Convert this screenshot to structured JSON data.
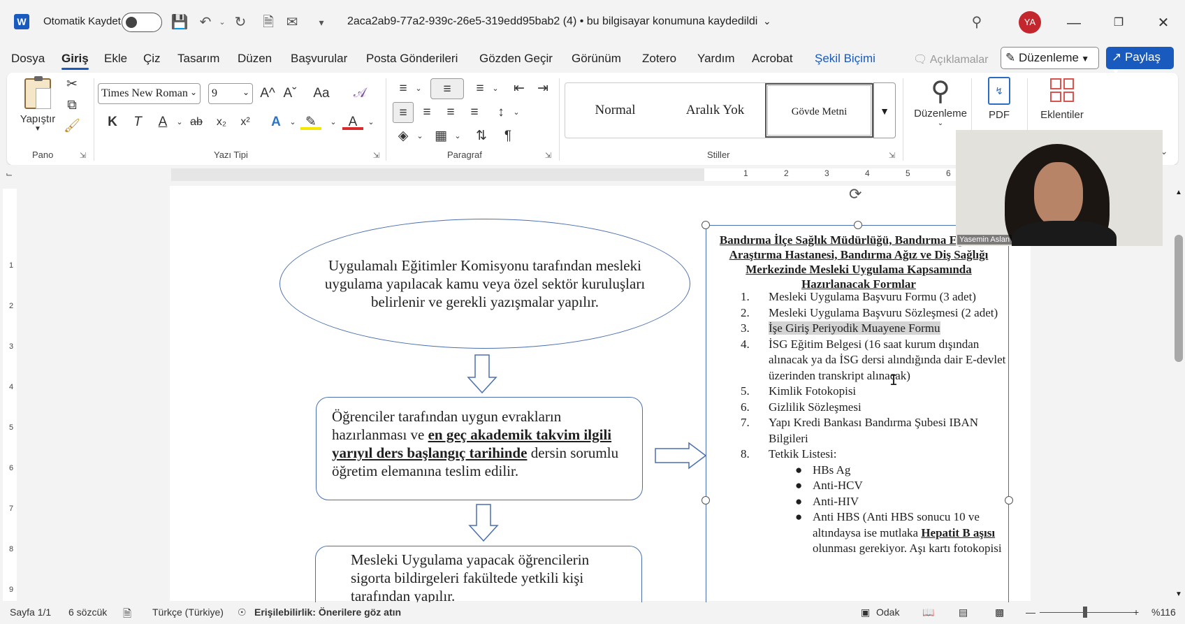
{
  "titlebar": {
    "app_icon": "W",
    "autosave_label": "Otomatik Kaydet",
    "doc_title": "2aca2ab9-77a2-939c-26e5-319edd95bab2 (4)  •  bu bilgisayar konumuna kaydedildi",
    "avatar_initials": "YA"
  },
  "menu": {
    "items": [
      "Dosya",
      "Giriş",
      "Ekle",
      "Çiz",
      "Tasarım",
      "Düzen",
      "Başvurular",
      "Posta Gönderileri",
      "Gözden Geçir",
      "Görünüm",
      "Zotero",
      "Yardım",
      "Acrobat",
      "Şekil Biçimi"
    ],
    "comments_label": "Açıklamalar",
    "editing_label": "Düzenleme",
    "share_label": "Paylaş"
  },
  "ribbon": {
    "paste_label": "Yapıştır",
    "clipboard_group": "Pano",
    "font_name": "Times New Roman",
    "font_size": "9",
    "font_group": "Yazı Tipi",
    "paragraph_group": "Paragraf",
    "styles": [
      "Normal",
      "Aralık Yok",
      "Gövde Metni"
    ],
    "styles_group": "Stiller",
    "editing_label": "Düzenleme",
    "pdf_label": "PDF",
    "addins_label": "Eklentiler",
    "bold": "K",
    "italic": "T",
    "underline": "A",
    "strike": "ab",
    "sub": "x₂",
    "sup": "x²",
    "change_case": "Aa",
    "grow_font": "A^",
    "shrink_font": "Aˇ"
  },
  "ruler": {
    "numbers": [
      "1",
      "2",
      "3",
      "4",
      "5",
      "6"
    ],
    "vnumbers": [
      "1",
      "2",
      "3",
      "4",
      "5",
      "6",
      "7",
      "8",
      "9"
    ]
  },
  "document": {
    "ellipse_text": "Uygulamalı Eğitimler Komisyonu tarafından mesleki uygulama yapılacak kamu veya özel sektör kuruluşları belirlenir ve gerekli yazışmalar yapılır.",
    "box2_pre": "Öğrenciler tarafından uygun evrakların hazırlanması ve ",
    "box2_bold": "en geç akademik takvim ilgili yarıyıl ders başlangıç tarihinde",
    "box2_post": " dersin sorumlu öğretim elemanına teslim edilir.",
    "box3_text": "Mesleki Uygulama yapacak öğrencilerin sigorta bildirgeleri fakültede yetkili kişi tarafından yapılır.",
    "side_title": "Bandırma İlçe Sağlık Müdürlüğü, Bandırma Eğitim ve Araştırma Hastanesi, Bandırma Ağız ve Diş Sağlığı Merkezinde Mesleki Uygulama Kapsamında Hazırlanacak Formlar",
    "list": [
      {
        "n": "1.",
        "t": "Mesleki Uygulama Başvuru Formu (3 adet)"
      },
      {
        "n": "2.",
        "t": "Mesleki Uygulama Başvuru Sözleşmesi (2 adet)"
      },
      {
        "n": "3.",
        "t": "İşe Giriş Periyodik Muayene Formu"
      },
      {
        "n": "4.",
        "t": "İSG Eğitim Belgesi (16 saat kurum dışından alınacak ya da İSG dersi alındığında dair E-devlet üzerinden transkript alınacak)"
      },
      {
        "n": "5.",
        "t": "Kimlik Fotokopisi"
      },
      {
        "n": "6.",
        "t": "Gizlilik Sözleşmesi"
      },
      {
        "n": "7.",
        "t": "Yapı Kredi Bankası Bandırma Şubesi IBAN Bilgileri"
      },
      {
        "n": "8.",
        "t": "Tetkik Listesi:"
      }
    ],
    "bullets": [
      "HBs Ag",
      "Anti-HCV",
      "Anti-HIV"
    ],
    "bullet4_pre": "Anti HBS (Anti HBS sonucu 10 ve altındaysa ise mutlaka ",
    "bullet4_bold": "Hepatit B aşısı",
    "bullet4_post": " olunması gerekiyor. Aşı kartı fotokopisi"
  },
  "webcam": {
    "name": "Yasemin Aslan"
  },
  "status": {
    "page": "Sayfa 1/1",
    "words": "6 sözcük",
    "language": "Türkçe (Türkiye)",
    "accessibility": "Erişilebilirlik: Önerilere göz atın",
    "focus": "Odak",
    "zoom": "%116"
  }
}
